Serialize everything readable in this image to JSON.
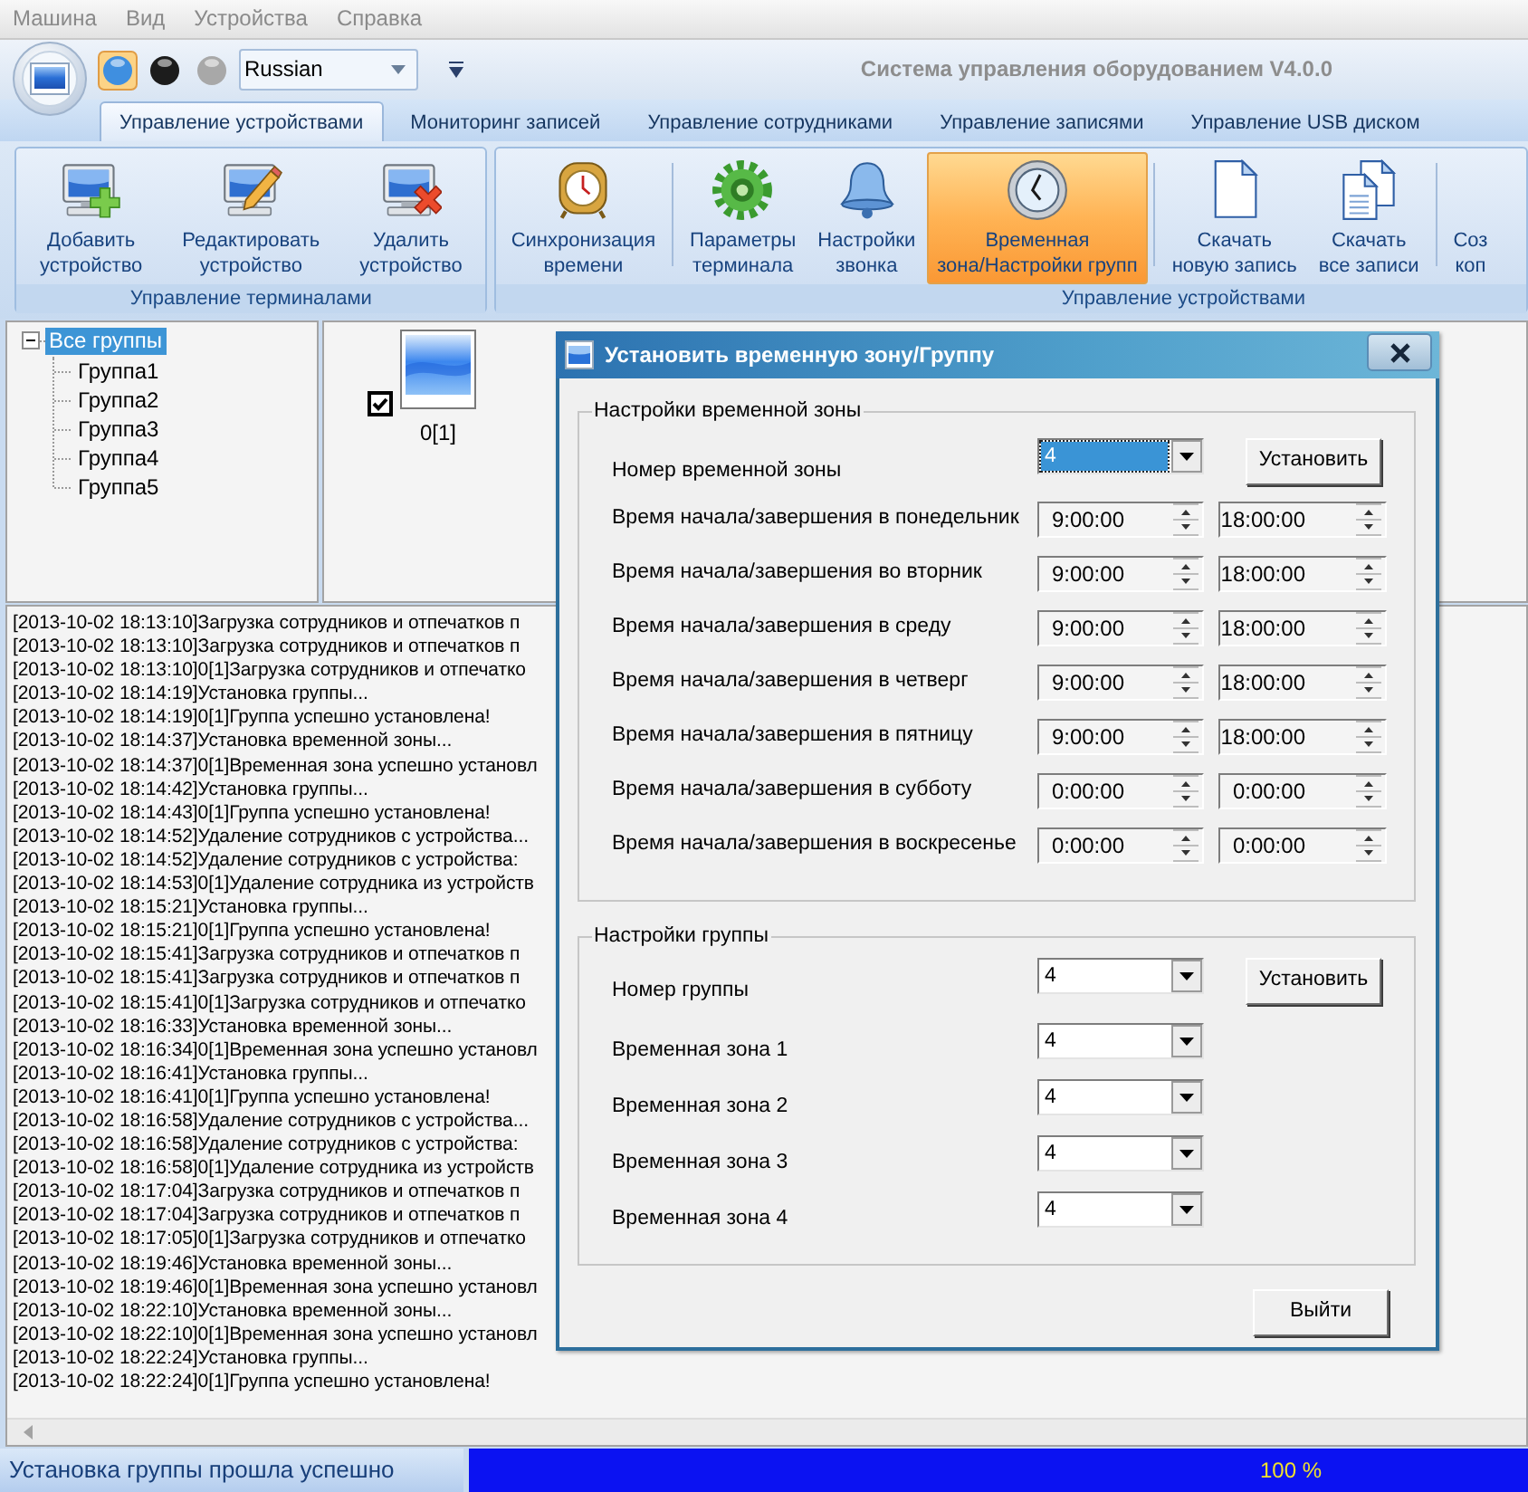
{
  "menu": [
    {
      "label": "Машина",
      "disabled": true
    },
    {
      "label": "Вид",
      "disabled": true
    },
    {
      "label": "Устройства",
      "disabled": true
    },
    {
      "label": "Справка",
      "disabled": true
    }
  ],
  "quick_access": {
    "theme_buttons": [
      {
        "color": "#3f8fe0",
        "selected": true
      },
      {
        "color": "#1c1c1c",
        "selected": false
      },
      {
        "color": "#a8a8a8",
        "selected": false
      }
    ],
    "language": "Russian"
  },
  "window": {
    "title": "Система управления оборудованием V4.0.0"
  },
  "tabs": [
    {
      "label": "Управление устройствами",
      "selected": true
    },
    {
      "label": "Мониторинг записей",
      "selected": false
    },
    {
      "label": "Управление сотрудниками",
      "selected": false
    },
    {
      "label": "Управление записями",
      "selected": false
    },
    {
      "label": "Управление USB диском",
      "selected": false
    }
  ],
  "ribbon": {
    "groups": [
      {
        "label": "Управление терминалами",
        "sections": [
          {
            "buttons": [
              {
                "label": "Добавить\nустройство",
                "selected": false
              },
              {
                "label": "Редактировать\nустройство",
                "selected": false
              },
              {
                "label": "Удалить\nустройство",
                "selected": false
              }
            ]
          }
        ]
      },
      {
        "label": "Управление устройствами",
        "sections": [
          {
            "buttons": [
              {
                "label": "Синхронизация\nвремени",
                "selected": false
              }
            ]
          },
          {
            "buttons": [
              {
                "label": "Параметры\nтерминала",
                "selected": false
              },
              {
                "label": "Настройки\nзвонка",
                "selected": false
              },
              {
                "label": "Временная\nзона/Настройки групп",
                "selected": true
              }
            ]
          },
          {
            "buttons": [
              {
                "label": "Скачать\nновую запись",
                "selected": false
              },
              {
                "label": "Скачать\nвсе записи",
                "selected": false
              }
            ]
          },
          {
            "buttons": [
              {
                "label": "Соз\nкоп",
                "selected": false
              }
            ]
          }
        ]
      }
    ]
  },
  "tree": [
    {
      "label": "Все группы",
      "expanded": true,
      "selected": true,
      "children": [
        {
          "label": "Группа1",
          "selected": false
        },
        {
          "label": "Группа2",
          "selected": false
        },
        {
          "label": "Группа3",
          "selected": false
        },
        {
          "label": "Группа4",
          "selected": false
        },
        {
          "label": "Группа5",
          "selected": false
        }
      ]
    }
  ],
  "devices": [
    {
      "label": "0[1]",
      "checked": true
    }
  ],
  "log": [
    "[2013-10-02 18:13:10]Загрузка сотрудников и отпечатков п",
    "[2013-10-02 18:13:10]Загрузка сотрудников и отпечатков п",
    "[2013-10-02 18:13:10]0[1]Загрузка сотрудников и отпечатко",
    "[2013-10-02 18:14:19]Установка группы...",
    "[2013-10-02 18:14:19]0[1]Группа успешно установлена!",
    "[2013-10-02 18:14:37]Установка временной зоны...",
    "[2013-10-02 18:14:37]0[1]Временная зона успешно установл",
    "[2013-10-02 18:14:42]Установка группы...",
    "[2013-10-02 18:14:43]0[1]Группа успешно установлена!",
    "[2013-10-02 18:14:52]Удаление сотрудников с устройства...",
    "[2013-10-02 18:14:52]Удаление сотрудников с устройства:",
    "[2013-10-02 18:14:53]0[1]Удаление сотрудника из устройств",
    "[2013-10-02 18:15:21]Установка группы...",
    "[2013-10-02 18:15:21]0[1]Группа успешно установлена!",
    "[2013-10-02 18:15:41]Загрузка сотрудников и отпечатков п",
    "[2013-10-02 18:15:41]Загрузка сотрудников и отпечатков п",
    "[2013-10-02 18:15:41]0[1]Загрузка сотрудников и отпечатко",
    "[2013-10-02 18:16:33]Установка временной зоны...",
    "[2013-10-02 18:16:34]0[1]Временная зона успешно установл",
    "[2013-10-02 18:16:41]Установка группы...",
    "[2013-10-02 18:16:41]0[1]Группа успешно установлена!",
    "[2013-10-02 18:16:58]Удаление сотрудников с устройства...",
    "[2013-10-02 18:16:58]Удаление сотрудников с устройства:",
    "[2013-10-02 18:16:58]0[1]Удаление сотрудника из устройств",
    "[2013-10-02 18:17:04]Загрузка сотрудников и отпечатков п",
    "[2013-10-02 18:17:04]Загрузка сотрудников и отпечатков п",
    "[2013-10-02 18:17:05]0[1]Загрузка сотрудников и отпечатко",
    "[2013-10-02 18:19:46]Установка временной зоны...",
    "[2013-10-02 18:19:46]0[1]Временная зона успешно установл",
    "[2013-10-02 18:22:10]Установка временной зоны...",
    "[2013-10-02 18:22:10]0[1]Временная зона успешно установл",
    "[2013-10-02 18:22:24]Установка группы...",
    "[2013-10-02 18:22:24]0[1]Группа успешно установлена!"
  ],
  "dialog": {
    "title": "Установить временную зону/Группу",
    "time_zone_settings": {
      "legend": "Настройки временной зоны",
      "number_label": "Номер временной зоны",
      "number": {
        "value": "4",
        "focused": true
      },
      "set_button": "Установить",
      "days": [
        {
          "label": "Время начала/завершения в понедельник",
          "start": "9:00:00",
          "end": "18:00:00"
        },
        {
          "label": "Время начала/завершения во вторник",
          "start": "9:00:00",
          "end": "18:00:00"
        },
        {
          "label": "Время начала/завершения в среду",
          "start": "9:00:00",
          "end": "18:00:00"
        },
        {
          "label": "Время начала/завершения в четверг",
          "start": "9:00:00",
          "end": "18:00:00"
        },
        {
          "label": "Время начала/завершения в пятницу",
          "start": "9:00:00",
          "end": "18:00:00"
        },
        {
          "label": "Время начала/завершения в субботу",
          "start": "0:00:00",
          "end": "0:00:00"
        },
        {
          "label": "Время начала/завершения в воскресенье",
          "start": "0:00:00",
          "end": "0:00:00"
        }
      ]
    },
    "group_settings": {
      "legend": "Настройки группы",
      "number_label": "Номер группы",
      "number": {
        "value": "4",
        "focused": false
      },
      "set_button": "Установить",
      "zones": [
        {
          "label": "Временная зона 1",
          "value": "4"
        },
        {
          "label": "Временная зона 2",
          "value": "4"
        },
        {
          "label": "Временная зона 3",
          "value": "4"
        },
        {
          "label": "Временная зона 4",
          "value": "4"
        }
      ]
    },
    "exit_button": "Выйти"
  },
  "status_bar": {
    "message": "Установка группы прошла успешно",
    "progress": {
      "level": 1,
      "reading": "100 %"
    }
  }
}
